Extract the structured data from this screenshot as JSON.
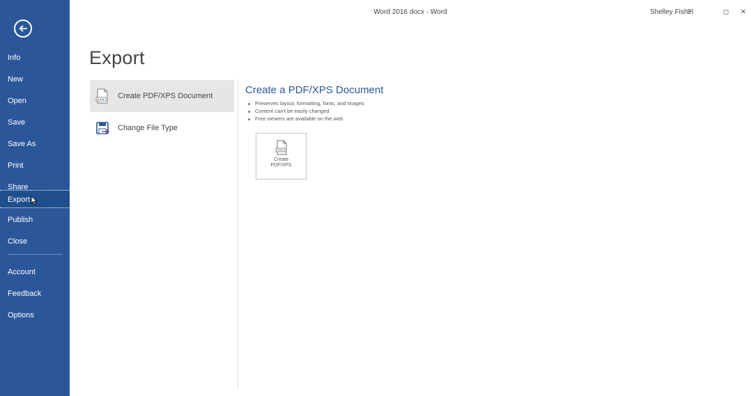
{
  "window": {
    "title": "Word 2016 docx - Word",
    "user": "Shelley Fishel",
    "help_label": "?",
    "restore_label": "◻",
    "close_label": "✕"
  },
  "nav": {
    "back_icon": "back-arrow-icon",
    "items": [
      {
        "label": "Info"
      },
      {
        "label": "New"
      },
      {
        "label": "Open"
      },
      {
        "label": "Save"
      },
      {
        "label": "Save As"
      },
      {
        "label": "Print"
      },
      {
        "label": "Share"
      },
      {
        "label": "Export",
        "active": true
      },
      {
        "label": "Publish"
      },
      {
        "label": "Close"
      },
      {
        "label": "Account"
      },
      {
        "label": "Feedback"
      },
      {
        "label": "Options"
      }
    ]
  },
  "export": {
    "heading": "Export",
    "options": [
      {
        "label": "Create PDF/XPS Document",
        "icon": "pdf-document-icon",
        "selected": true
      },
      {
        "label": "Change File Type",
        "icon": "change-file-type-icon",
        "selected": false
      }
    ],
    "detail": {
      "title": "Create a PDF/XPS Document",
      "bullets": [
        "Preserves layout, formatting, fonts, and images",
        "Content can't be easily changed",
        "Free viewers are available on the web"
      ],
      "button_line1": "Create",
      "button_line2": "PDF/XPS",
      "button_icon": "pdf-xps-file-icon"
    }
  },
  "colors": {
    "nav_background": "#2b579a",
    "accent": "#2b579a",
    "selected_option": "#e6e6e6"
  }
}
